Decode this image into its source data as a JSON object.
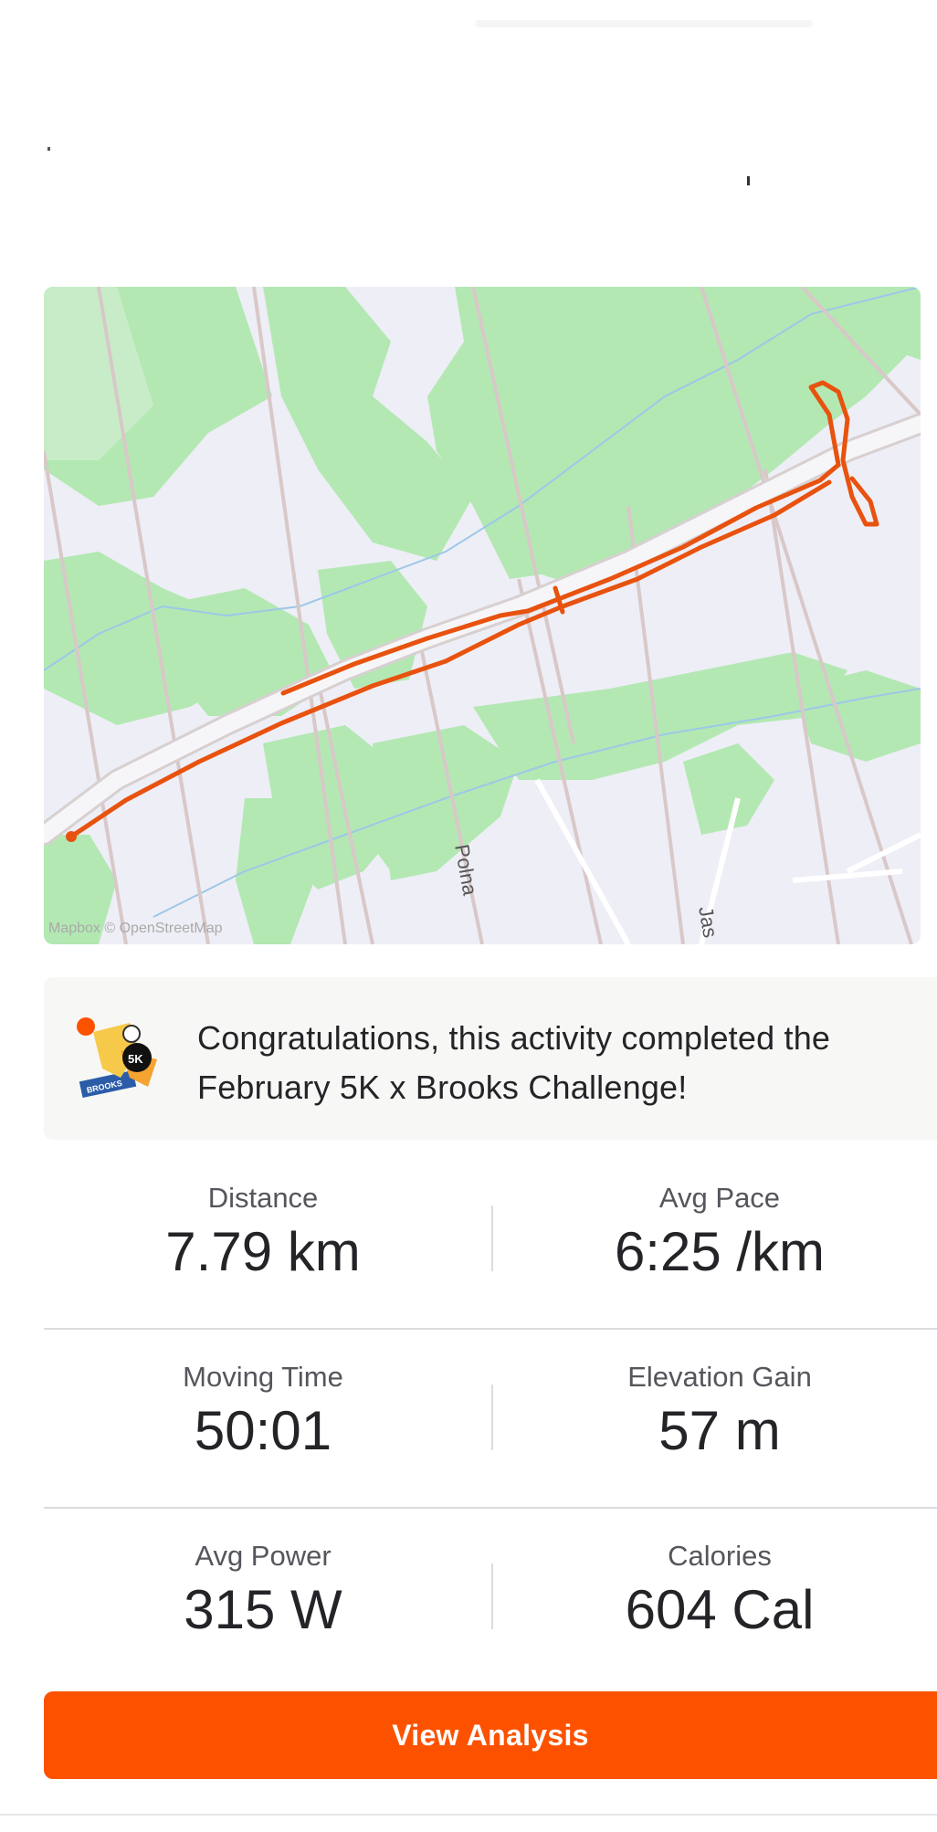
{
  "map": {
    "attribution": "Mapbox  © OpenStreetMap",
    "street_labels": [
      "Polna",
      "Jas"
    ],
    "route_color": "#e8520f"
  },
  "challenge": {
    "message": "Congratulations, this activity completed the February 5K x Brooks Challenge!",
    "badge": {
      "distance_text": "5K",
      "brand_text": "BROOKS"
    }
  },
  "stats": [
    [
      {
        "label": "Distance",
        "value": "7.79 km"
      },
      {
        "label": "Avg Pace",
        "value": "6:25 /km"
      }
    ],
    [
      {
        "label": "Moving Time",
        "value": "50:01"
      },
      {
        "label": "Elevation Gain",
        "value": "57 m"
      }
    ],
    [
      {
        "label": "Avg Power",
        "value": "315 W"
      },
      {
        "label": "Calories",
        "value": "604 Cal"
      }
    ]
  ],
  "actions": {
    "view_analysis": "View Analysis"
  },
  "colors": {
    "accent": "#fc5200",
    "map_green": "#b3e8b3",
    "map_background": "#eeeef6"
  }
}
